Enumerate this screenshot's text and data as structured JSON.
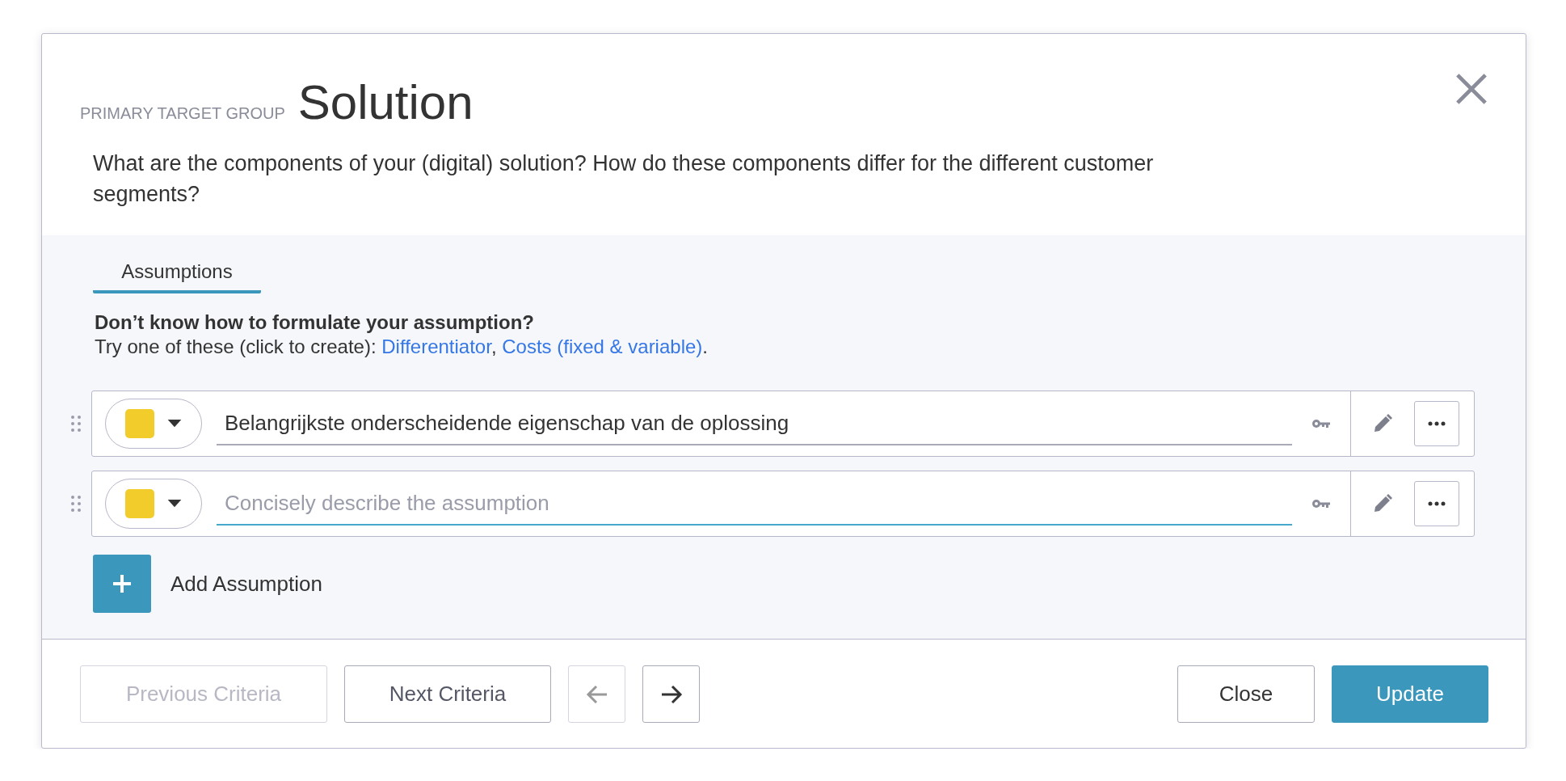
{
  "dialog": {
    "eyebrow": "PRIMARY TARGET GROUP",
    "title": "Solution",
    "question": "What are the components of your (digital) solution? How do these components differ for the different customer segments?"
  },
  "tabs": [
    {
      "label": "Assumptions",
      "selected": true
    }
  ],
  "hint": {
    "heading": "Don’t know how to formulate your assumption?",
    "intro": "Try one of these (click to create): ",
    "links": [
      "Differentiator",
      "Costs (fixed & variable)"
    ],
    "separator": ", ",
    "end": "."
  },
  "assumptions": [
    {
      "color": "#f2cc2a",
      "value": "Belangrijkste onderscheidende eigenschap van de oplossing",
      "focused": false
    },
    {
      "color": "#f2cc2a",
      "placeholder": "Concisely describe the assumption",
      "focused": true
    }
  ],
  "add_button": {
    "label": "Add Assumption"
  },
  "footer": {
    "nav": [
      {
        "label": "Previous Criteria",
        "disabled": true
      },
      {
        "label": "Next Criteria",
        "disabled": false
      }
    ],
    "arrows": [
      {
        "kind": "back",
        "disabled": true
      },
      {
        "kind": "forward",
        "disabled": false
      }
    ],
    "actions": [
      {
        "label": "Close",
        "kind": "secondary"
      },
      {
        "label": "Update",
        "kind": "primary"
      }
    ]
  }
}
